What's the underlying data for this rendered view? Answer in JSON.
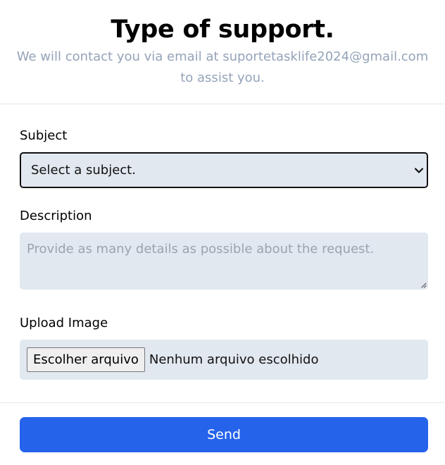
{
  "header": {
    "title": "Type of support.",
    "subtitle": "We will contact you via email at suportetasklife2024@gmail.com to assist you."
  },
  "subject": {
    "label": "Subject",
    "selected": "Select a subject."
  },
  "description": {
    "label": "Description",
    "placeholder": "Provide as many details as possible about the request."
  },
  "upload": {
    "label": "Upload Image",
    "button_label": "Escolher arquivo",
    "status": "Nenhum arquivo escolhido"
  },
  "footer": {
    "send_label": "Send"
  },
  "colors": {
    "accent": "#2563eb",
    "field_bg": "#e2e8f0",
    "muted_text": "#94a3b8"
  },
  "icons": {
    "select": "chevron-down-icon",
    "textarea": "resize-handle-icon"
  }
}
